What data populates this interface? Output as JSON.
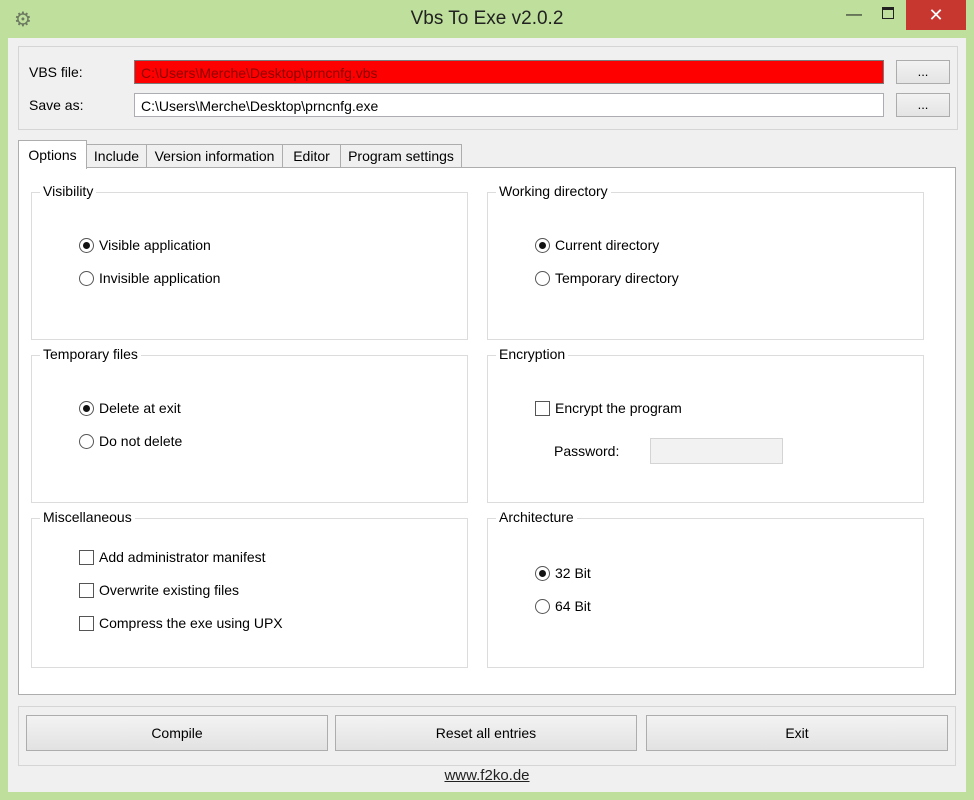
{
  "window": {
    "title": "Vbs To Exe v2.0.2",
    "app_icon": "gear-icon",
    "minimize": "—",
    "close": "✕"
  },
  "files": {
    "vbs_label": "VBS file:",
    "vbs_value": "C:\\Users\\Merche\\Desktop\\prncnfg.vbs",
    "vbs_highlight_color": "#ff0000",
    "save_label": "Save as:",
    "save_value": "C:\\Users\\Merche\\Desktop\\prncnfg.exe",
    "browse_label": "...",
    "browse_save_label": "..."
  },
  "tabs": [
    {
      "label": "Options",
      "active": true
    },
    {
      "label": "Include",
      "active": false
    },
    {
      "label": "Version information",
      "active": false
    },
    {
      "label": "Editor",
      "active": false
    },
    {
      "label": "Program settings",
      "active": false
    }
  ],
  "visibility": {
    "title": "Visibility",
    "options": [
      {
        "label": "Visible application",
        "selected": true
      },
      {
        "label": "Invisible application",
        "selected": false
      }
    ]
  },
  "working_directory": {
    "title": "Working directory",
    "options": [
      {
        "label": "Current directory",
        "selected": true
      },
      {
        "label": "Temporary directory",
        "selected": false
      }
    ]
  },
  "temporary_files": {
    "title": "Temporary files",
    "options": [
      {
        "label": "Delete at exit",
        "selected": true
      },
      {
        "label": "Do not delete",
        "selected": false
      }
    ]
  },
  "encryption": {
    "title": "Encryption",
    "encrypt_label": "Encrypt the program",
    "encrypt_checked": false,
    "password_label": "Password:",
    "password_value": ""
  },
  "miscellaneous": {
    "title": "Miscellaneous",
    "options": [
      {
        "label": "Add administrator manifest",
        "checked": false
      },
      {
        "label": "Overwrite existing files",
        "checked": false
      },
      {
        "label": "Compress the exe using UPX",
        "checked": false
      }
    ]
  },
  "architecture": {
    "title": "Architecture",
    "options": [
      {
        "label": "32 Bit",
        "selected": true
      },
      {
        "label": "64 Bit",
        "selected": false
      }
    ]
  },
  "buttons": {
    "compile": "Compile",
    "reset": "Reset all entries",
    "exit": "Exit"
  },
  "footer": {
    "link": "www.f2ko.de"
  }
}
